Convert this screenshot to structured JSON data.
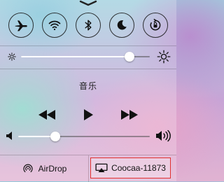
{
  "toggles": [
    {
      "name": "airplane-mode",
      "icon": "airplane-icon"
    },
    {
      "name": "wifi",
      "icon": "wifi-icon"
    },
    {
      "name": "bluetooth",
      "icon": "bluetooth-icon"
    },
    {
      "name": "do-not-disturb",
      "icon": "moon-icon"
    },
    {
      "name": "rotation-lock",
      "icon": "rotation-lock-icon"
    }
  ],
  "brightness": {
    "level": 0.84
  },
  "music": {
    "title": "音乐"
  },
  "volume": {
    "level": 0.28
  },
  "airdrop": {
    "label": "AirDrop"
  },
  "airplay": {
    "label": "Coocaa-11873",
    "highlight_color": "#e03030"
  }
}
